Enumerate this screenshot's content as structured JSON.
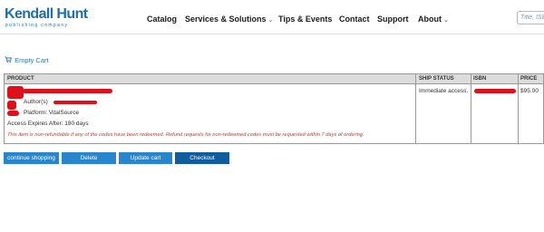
{
  "header": {
    "logo_main": "Kendall Hunt",
    "logo_sub": "publishing company",
    "nav": [
      {
        "label": "Catalog",
        "dropdown": false
      },
      {
        "label": "Services & Solutions",
        "dropdown": true
      },
      {
        "label": "Tips & Events",
        "dropdown": false
      },
      {
        "label": "Contact",
        "dropdown": false
      },
      {
        "label": "Support",
        "dropdown": false
      },
      {
        "label": "About",
        "dropdown": true
      }
    ],
    "search_placeholder": "Title, ISBN"
  },
  "cart": {
    "empty_cart_label": "Empty Cart",
    "columns": {
      "product": "PRODUCT",
      "ship_status": "SHIP STATUS",
      "isbn": "ISBN",
      "price": "PRICE"
    },
    "item": {
      "author_label": "Author(s)",
      "platform": "Platform: VitalSource",
      "access_expires": "Access Expires After: 180 days",
      "refund_note": "This item is non-refundable if any of the codes have been redeemed. Refund requests for non-redeemed codes must be requested within 7 days of ordering.",
      "ship_status": "Immediate access.",
      "price": "$95.00"
    }
  },
  "buttons": {
    "continue": "continue shopping",
    "delete": "Delete",
    "update": "Update cart",
    "checkout": "Checkout"
  },
  "colors": {
    "brand": "#1d6fb0",
    "link": "#2a7ab8",
    "button": "#2a86cc",
    "button_dark": "#0f5c9e",
    "warning": "#d33a2c",
    "redaction": "#e0101a"
  }
}
